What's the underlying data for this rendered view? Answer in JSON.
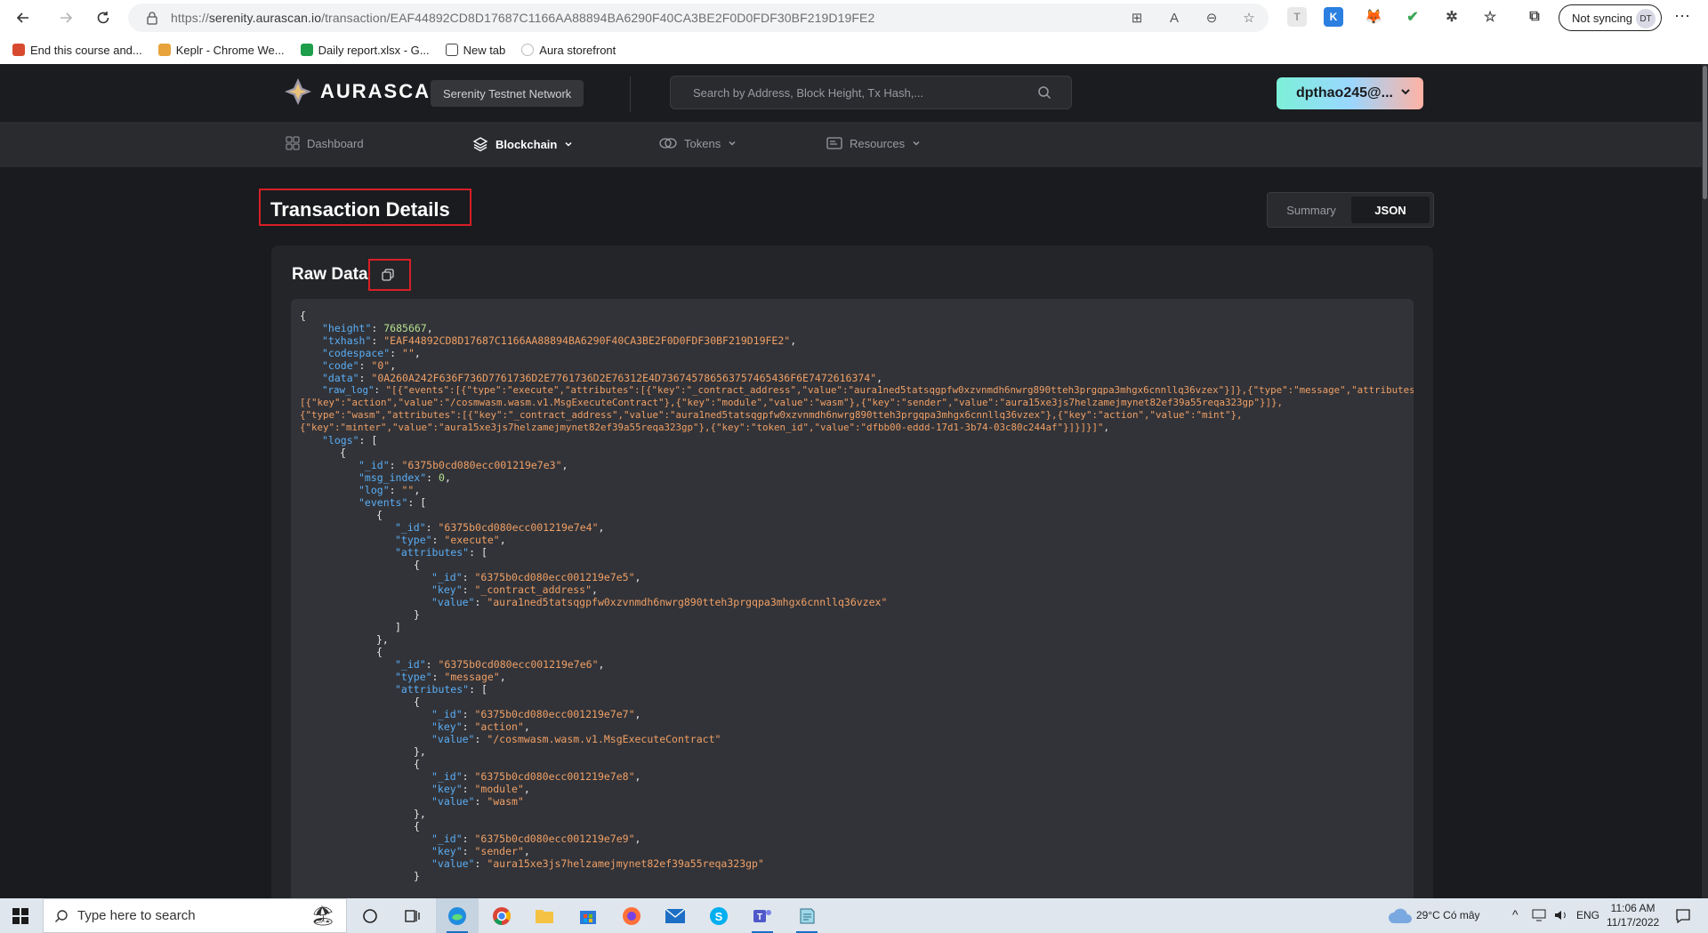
{
  "browser": {
    "url_scheme": "https://",
    "url_host": "serenity.aurascan.io",
    "url_path": "/transaction/EAF44892CD8D17687C1166AA88894BA6290F40CA3BE2F0D0FDF30BF219D19FE2",
    "sync_label": "Not syncing",
    "profile_initials": "DT",
    "bookmarks": [
      {
        "label": "End this course and...",
        "color": "#d84a2f"
      },
      {
        "label": "Keplr - Chrome We...",
        "color": "#e8a33d"
      },
      {
        "label": "Daily report.xlsx - G...",
        "color": "#1e9e4a"
      },
      {
        "label": "New tab",
        "color": "#444444"
      },
      {
        "label": "Aura storefront",
        "color": "#bbbbbb"
      }
    ]
  },
  "header": {
    "logo_text": "AURASCAN",
    "network": "Serenity Testnet Network",
    "search_placeholder": "Search by Address, Block Height, Tx Hash,...",
    "wallet_label": "dpthao245@..."
  },
  "nav": {
    "dashboard": "Dashboard",
    "blockchain": "Blockchain",
    "tokens": "Tokens",
    "resources": "Resources"
  },
  "page": {
    "title": "Transaction Details",
    "toggle_summary": "Summary",
    "toggle_json": "JSON",
    "raw_data_title": "Raw Data"
  },
  "json": {
    "height": "7685667",
    "txhash": "\"EAF44892CD8D17687C1166AA88894BA6290F40CA3BE2F0D0FDF30BF219D19FE2\"",
    "codespace": "\"\"",
    "code": "\"0\"",
    "data": "\"0A260A242F636F736D7761736D2E7761736D2E76312E4D736745786563757465436F6E7472616374\"",
    "raw_log_1": "\"[{\"events\":[{\"type\":\"execute\",\"attributes\":[{\"key\":\"_contract_address\",\"value\":\"aura1ned5tatsqgpfw0xzvnmdh6nwrg890tteh3prgqpa3mhgx6cnnllq36vzex\"}]},{\"type\":\"message\",\"attributes\":",
    "raw_log_2": "[{\"key\":\"action\",\"value\":\"/cosmwasm.wasm.v1.MsgExecuteContract\"},{\"key\":\"module\",\"value\":\"wasm\"},{\"key\":\"sender\",\"value\":\"aura15xe3js7helzamejmynet82ef39a55reqa323gp\"}]},",
    "raw_log_3": "{\"type\":\"wasm\",\"attributes\":[{\"key\":\"_contract_address\",\"value\":\"aura1ned5tatsqgpfw0xzvnmdh6nwrg890tteh3prgqpa3mhgx6cnnllq36vzex\"},{\"key\":\"action\",\"value\":\"mint\"},",
    "raw_log_4": "{\"key\":\"minter\",\"value\":\"aura15xe3js7helzamejmynet82ef39a55reqa323gp\"},{\"key\":\"token_id\",\"value\":\"dfbb00-eddd-17d1-3b74-03c80c244af\"}]}]}]\"",
    "log_id": "\"6375b0cd080ecc001219e7e3\"",
    "msg_index": "0",
    "log": "\"\"",
    "event1_id": "\"6375b0cd080ecc001219e7e4\"",
    "event1_type": "\"execute\"",
    "attr1_id": "\"6375b0cd080ecc001219e7e5\"",
    "attr1_key": "\"_contract_address\"",
    "attr1_value": "\"aura1ned5tatsqgpfw0xzvnmdh6nwrg890tteh3prgqpa3mhgx6cnnllq36vzex\"",
    "event2_id": "\"6375b0cd080ecc001219e7e6\"",
    "event2_type": "\"message\"",
    "attr2_id": "\"6375b0cd080ecc001219e7e7\"",
    "attr2_key": "\"action\"",
    "attr2_value": "\"/cosmwasm.wasm.v1.MsgExecuteContract\"",
    "attr3_id": "\"6375b0cd080ecc001219e7e8\"",
    "attr3_key": "\"module\"",
    "attr3_value": "\"wasm\"",
    "attr4_id": "\"6375b0cd080ecc001219e7e9\"",
    "attr4_key": "\"sender\"",
    "attr4_value": "\"aura15xe3js7helzamejmynet82ef39a55reqa323gp\""
  },
  "taskbar": {
    "search_placeholder": "Type here to search",
    "weather": "29°C  Có mây",
    "language": "ENG",
    "time": "11:06 AM",
    "date": "11/17/2022"
  },
  "colors": {
    "highlight_border": "#d61f26",
    "json_key": "#5aaef6",
    "json_string": "#f0a066",
    "json_number": "#b5e08e"
  }
}
